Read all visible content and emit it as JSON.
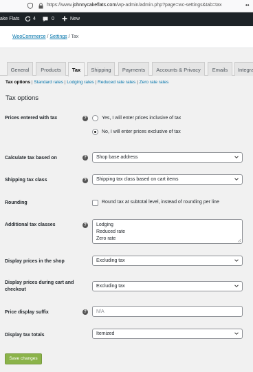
{
  "browser": {
    "url_prefix": "https://www.",
    "url_domain": "johnnycakeflats.com",
    "url_path": "/wp-admin/admin.php?page=wc-settings&tab=tax",
    "more": "••"
  },
  "admin_bar": {
    "site_name": "ake Flats",
    "updates_count": "4",
    "comments_count": "0",
    "new_label": "New"
  },
  "breadcrumb": {
    "woocommerce": "WooCommerce",
    "sep1": "/",
    "settings": "Settings",
    "sep2": "/",
    "current": "Tax"
  },
  "tabs": [
    "General",
    "Products",
    "Tax",
    "Shipping",
    "Payments",
    "Accounts & Privacy",
    "Emails",
    "Integration"
  ],
  "subnav": {
    "current": "Tax options",
    "sep": "|",
    "links": [
      "Standard rates",
      "Lodging rates",
      "Reduced rate rates",
      "Zero rate rates"
    ]
  },
  "section_title": "Tax options",
  "fields": {
    "prices_entered": {
      "label": "Prices entered with tax",
      "options": [
        "Yes, I will enter prices inclusive of tax",
        "No, I will enter prices exclusive of tax"
      ],
      "selected_index": 1
    },
    "calculate_based_on": {
      "label": "Calculate tax based on",
      "value": "Shop base address"
    },
    "shipping_tax_class": {
      "label": "Shipping tax class",
      "value": "Shipping tax class based on cart items"
    },
    "rounding": {
      "label": "Rounding",
      "checkbox_label": "Round tax at subtotal level, instead of rounding per line",
      "checked": false
    },
    "additional_classes": {
      "label": "Additional tax classes",
      "lines": [
        "Lodging",
        "Reduced rate",
        "Zero rate"
      ]
    },
    "display_shop": {
      "label": "Display prices in the shop",
      "value": "Excluding tax"
    },
    "display_cart": {
      "label": "Display prices during cart and checkout",
      "value": "Excluding tax"
    },
    "price_suffix": {
      "label": "Price display suffix",
      "placeholder": "N/A"
    },
    "display_totals": {
      "label": "Display tax totals",
      "value": "Itemized"
    }
  },
  "save_label": "Save changes",
  "colors": {
    "admin_bar_bg": "#1d2327",
    "link": "#0073aa",
    "save_button": "#8bb34a"
  }
}
